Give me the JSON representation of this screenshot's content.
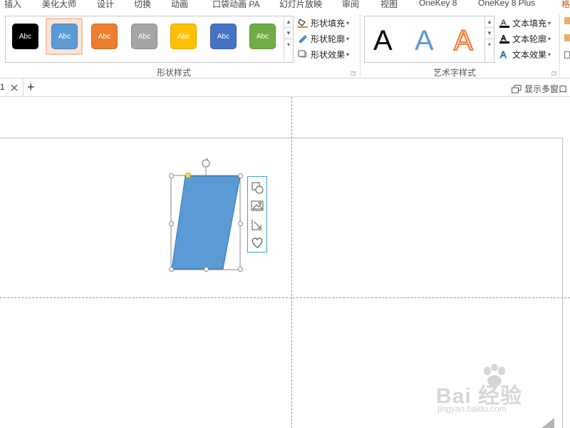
{
  "tabs": [
    "插入",
    "美化大师",
    "设计",
    "切换",
    "动画",
    "口袋动画 PA",
    "幻灯片放映",
    "审阅",
    "视图",
    "OneKey 8",
    "OneKey 8 Plus",
    "格"
  ],
  "shape_styles": {
    "swatches": [
      {
        "label": "Abc",
        "color": "#000000",
        "selected": false
      },
      {
        "label": "Abc",
        "color": "#5b9bd5",
        "selected": true
      },
      {
        "label": "Abc",
        "color": "#ed7d31",
        "selected": false
      },
      {
        "label": "Abc",
        "color": "#a5a5a5",
        "selected": false
      },
      {
        "label": "Abc",
        "color": "#ffc000",
        "selected": false
      },
      {
        "label": "Abc",
        "color": "#4472c4",
        "selected": false
      },
      {
        "label": "Abc",
        "color": "#70ad47",
        "selected": false
      }
    ],
    "fill_label": "形状填充",
    "outline_label": "形状轮廓",
    "effects_label": "形状效果",
    "group_label": "形状样式"
  },
  "wordart_styles": {
    "letters": [
      {
        "text": "A",
        "style": "plain-black"
      },
      {
        "text": "A",
        "style": "blue-gradient"
      },
      {
        "text": "A",
        "style": "orange-outline"
      }
    ],
    "text_fill_label": "文本填充",
    "text_outline_label": "文本轮廓",
    "text_effects_label": "文本效果",
    "group_label": "艺术字样式"
  },
  "doc_tab": {
    "number": "1",
    "close_icon": "close-icon",
    "add_icon": "plus-icon"
  },
  "multi_window_label": "显示多窗口",
  "shape": {
    "type": "parallelogram",
    "fill": "#5b9bd5"
  },
  "layout_options": [
    "shapes-icon",
    "picture-icon",
    "resize-icon",
    "heart-icon"
  ],
  "watermark": {
    "main": "Bai 经验",
    "sub": "jingyan.baidu.com"
  }
}
